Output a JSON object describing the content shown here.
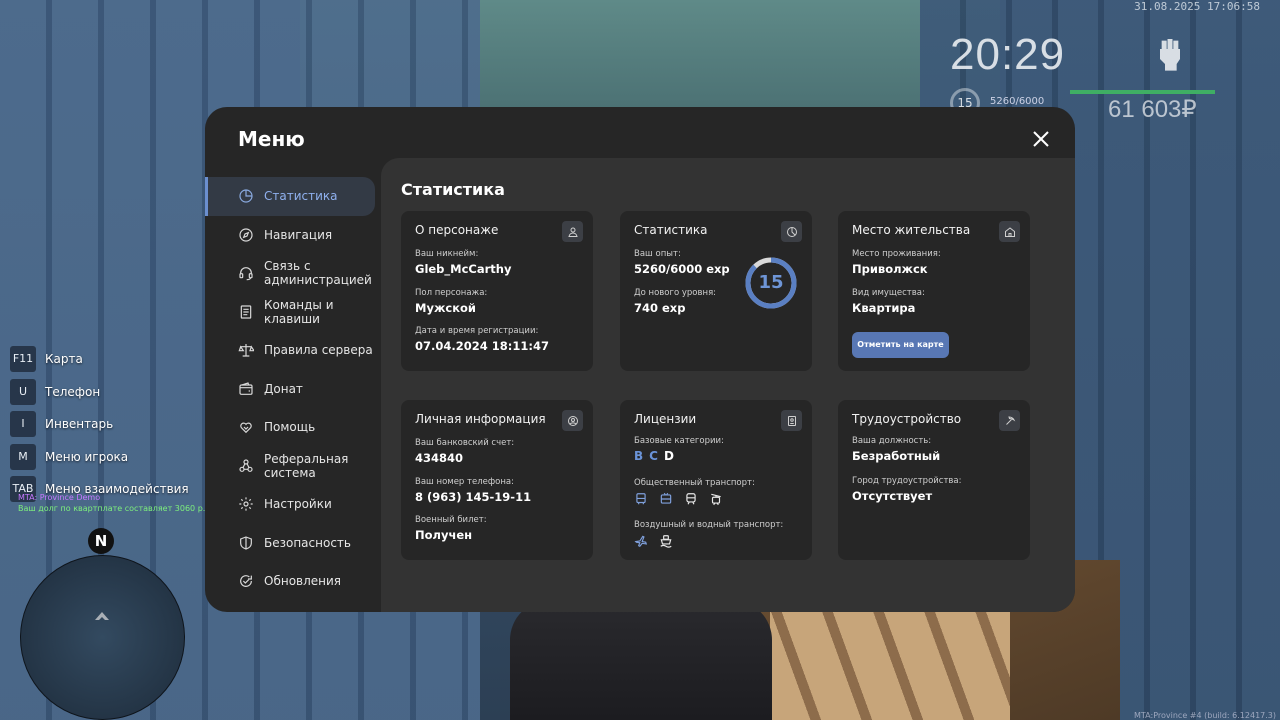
{
  "hud": {
    "datetime": "31.08.2025 17:06:58",
    "time": "20:29",
    "level": "15",
    "exp": "5260/6000",
    "money": "61 603₽"
  },
  "hints": [
    {
      "key": "F11",
      "label": "Карта"
    },
    {
      "key": "U",
      "label": "Телефон"
    },
    {
      "key": "I",
      "label": "Инвентарь"
    },
    {
      "key": "M",
      "label": "Меню игрока"
    },
    {
      "key": "TAB",
      "label": "Меню взаимодействия"
    }
  ],
  "chat": {
    "line1": "MTA: Province Demo",
    "line2": "Ваш долг по квартплате составляет 3060 р."
  },
  "minimap": {
    "compass": "N"
  },
  "build": "MTA:Province #4 (build: 6.12417.3)",
  "menu": {
    "title": "Меню",
    "sidebar": [
      {
        "label": "Статистика",
        "icon": "pie-chart-icon"
      },
      {
        "label": "Навигация",
        "icon": "compass-icon"
      },
      {
        "label": "Связь с администрацией",
        "icon": "headset-icon"
      },
      {
        "label": "Команды и клавиши",
        "icon": "document-icon"
      },
      {
        "label": "Правила сервера",
        "icon": "scales-icon"
      },
      {
        "label": "Донат",
        "icon": "wallet-icon"
      },
      {
        "label": "Помощь",
        "icon": "heart-hands-icon"
      },
      {
        "label": "Реферальная система",
        "icon": "network-icon"
      },
      {
        "label": "Настройки",
        "icon": "gear-icon"
      },
      {
        "label": "Безопасность",
        "icon": "shield-icon"
      },
      {
        "label": "Обновления",
        "icon": "refresh-check-icon"
      }
    ],
    "content_title": "Статистика",
    "character": {
      "title": "О персонаже",
      "nick_label": "Ваш никнейм:",
      "nick": "Gleb_McCarthy",
      "gender_label": "Пол персонажа:",
      "gender": "Мужской",
      "reg_label": "Дата и время регистрации:",
      "reg": "07.04.2024 18:11:47"
    },
    "stats": {
      "title": "Статистика",
      "exp_label": "Ваш опыт:",
      "exp": "5260/6000 exp",
      "next_label": "До нового уровня:",
      "next": "740 exp",
      "level": "15",
      "progress": 0.877
    },
    "residence": {
      "title": "Место жительства",
      "place_label": "Место проживания:",
      "place": "Приволжск",
      "type_label": "Вид имущества:",
      "type": "Квартира",
      "button": "Отметить на карте"
    },
    "personal": {
      "title": "Личная информация",
      "bank_label": "Ваш банковский счет:",
      "bank": "434840",
      "phone_label": "Ваш номер телефона:",
      "phone": "8 (963) 145-19-11",
      "military_label": "Военный билет:",
      "military": "Получен"
    },
    "licenses": {
      "title": "Лицензии",
      "base_label": "Базовые категории:",
      "categories": [
        {
          "name": "B",
          "active": true
        },
        {
          "name": "C",
          "active": true
        },
        {
          "name": "D",
          "active": false
        }
      ],
      "public_label": "Общественный транспорт:",
      "air_label": "Воздушный и водный транспорт:"
    },
    "employment": {
      "title": "Трудоустройство",
      "position_label": "Ваша должность:",
      "position": "Безработный",
      "city_label": "Город трудоустройства:",
      "city": "Отсутствует"
    },
    "colors": {
      "accent": "#6b8fcf",
      "button": "#5877b4",
      "window": "#262626",
      "content": "#333333"
    }
  }
}
